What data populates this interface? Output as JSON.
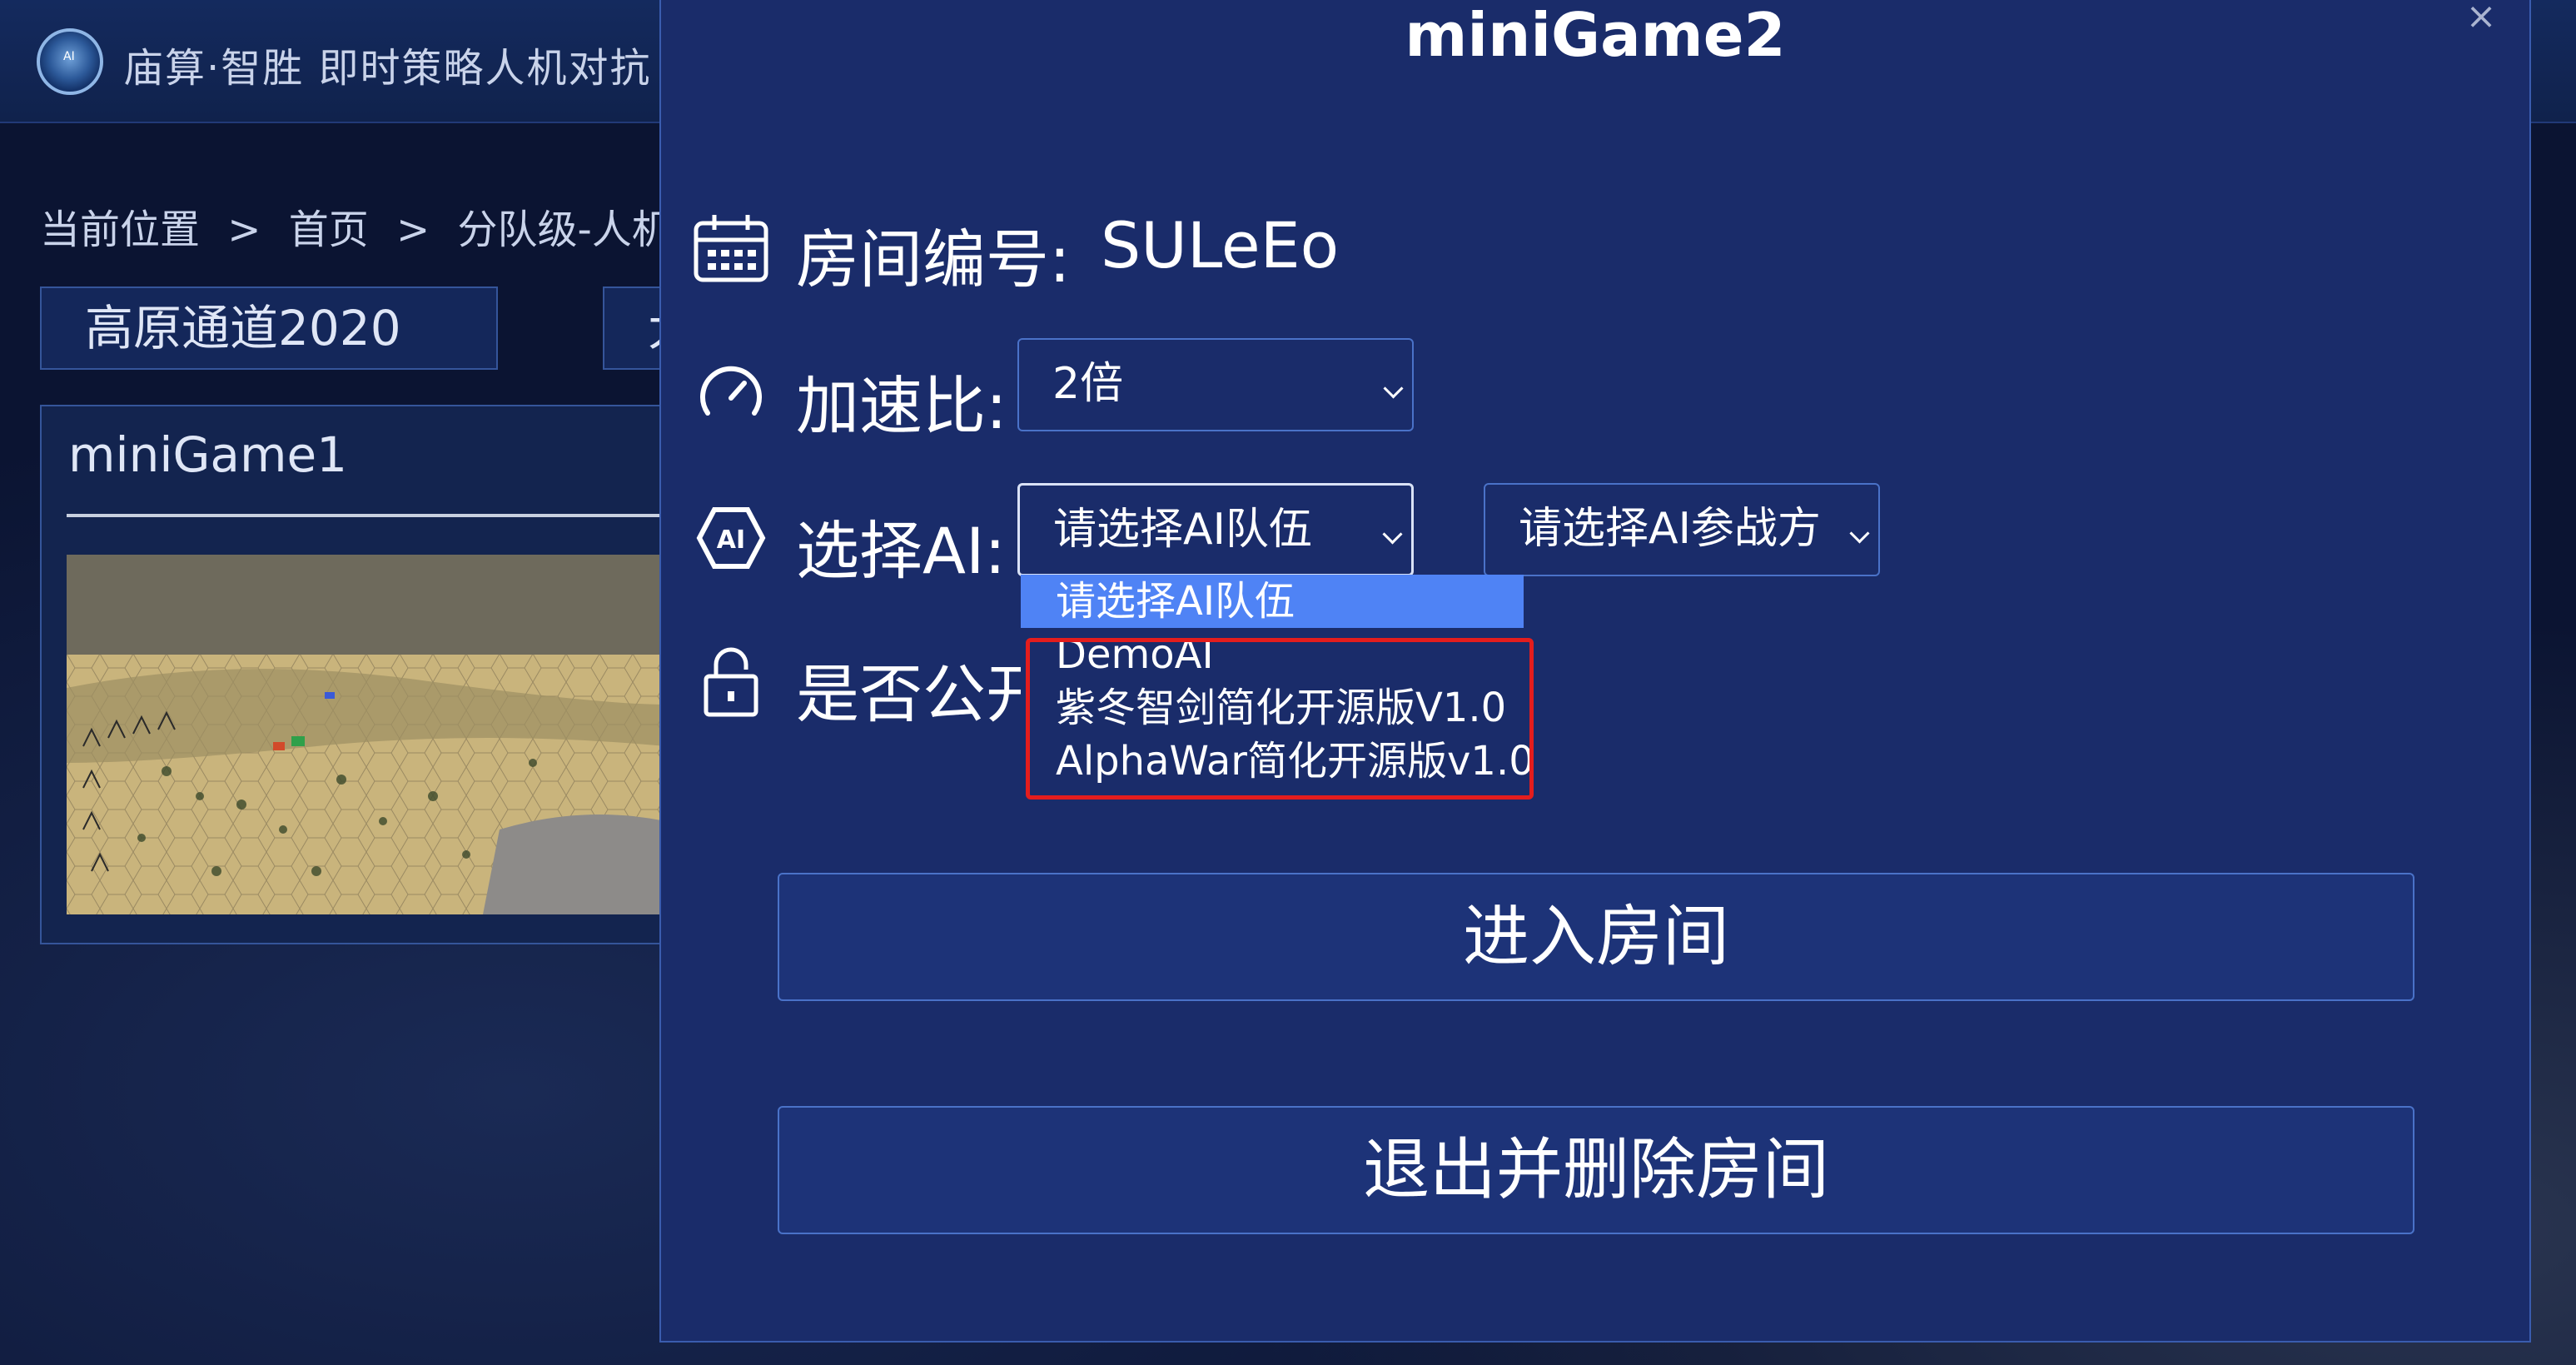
{
  "app": {
    "title": "庙算·智胜  即时策略人机对抗"
  },
  "breadcrumb": {
    "items": [
      "当前位置",
      ">",
      "首页",
      ">",
      "分队级-人机对抗"
    ]
  },
  "map_tabs": [
    "高原通道2020",
    "大"
  ],
  "room_card": {
    "title": "miniGame1"
  },
  "modal": {
    "title": "miniGame2",
    "close_glyph": "×",
    "room_number_label": "房间编号:",
    "room_number_value": "SULeEo",
    "speed_label": "加速比:",
    "speed_value": "2倍",
    "ai_label": "选择AI:",
    "ai_team_value": "请选择AI队伍",
    "ai_side_value": "请选择AI参战方",
    "public_label": "是否公开",
    "ai_team_options": [
      "请选择AI队伍",
      "DemoAI",
      "紫冬智剑简化开源版V1.0",
      "AlphaWar简化开源版v1.0"
    ],
    "enter_button": "进入房间",
    "exit_button": "退出并删除房间"
  },
  "colors": {
    "modal_bg": "#1a2c6a",
    "selected_option": "#4f83f5",
    "highlight_box": "#e41d1d",
    "page_bg": "#0b1432"
  },
  "icons": [
    "calendar-icon",
    "speedometer-icon",
    "ai-hexagon-icon",
    "lock-icon",
    "close-icon",
    "chevron-down-icon"
  ]
}
